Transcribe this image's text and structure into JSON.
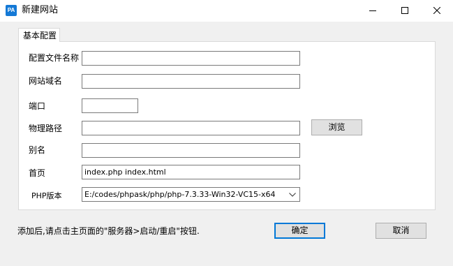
{
  "window": {
    "title": "新建网站",
    "logo_text": "PA",
    "icons": {
      "minimize": "minimize-icon",
      "maximize": "maximize-icon",
      "close": "close-icon"
    }
  },
  "tabs": [
    {
      "label": "基本配置",
      "active": true
    }
  ],
  "form": {
    "config_name": {
      "label": "配置文件名称",
      "value": ""
    },
    "domain": {
      "label": "网站域名",
      "value": ""
    },
    "port": {
      "label": "端口",
      "value": ""
    },
    "path": {
      "label": "物理路径",
      "value": "",
      "browse_label": "浏览"
    },
    "alias": {
      "label": "别名",
      "value": ""
    },
    "index": {
      "label": "首页",
      "value": "index.php index.html"
    },
    "php": {
      "label": "PHP版本",
      "value": "E:/codes/phpask/php/php-7.3.33-Win32-VC15-x64"
    }
  },
  "footer": {
    "note": "添加后,请点击主页面的\"服务器>启动/重启\"按钮.",
    "confirm_label": "确定",
    "cancel_label": "取消"
  },
  "colors": {
    "accent": "#0078d7",
    "logo": "#1479d6"
  }
}
